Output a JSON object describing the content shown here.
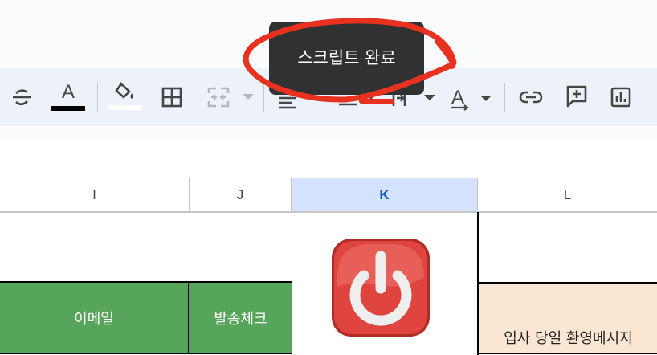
{
  "tooltip": {
    "text": "스크립트 완료"
  },
  "toolbar": {
    "icons": [
      "strikethrough-icon",
      "text-color-icon",
      "fill-color-icon",
      "borders-icon",
      "merge-cells-icon",
      "horizontal-align-icon",
      "vertical-align-icon",
      "text-wrap-icon",
      "text-rotation-icon",
      "insert-link-icon",
      "insert-comment-icon",
      "insert-chart-icon"
    ],
    "text_color_glyph": "A",
    "text_color": "#000000",
    "fill_color": "#ffffff"
  },
  "columns": [
    "I",
    "J",
    "K",
    "L"
  ],
  "selected_column": "K",
  "cells": {
    "email": "이메일",
    "send_check": "발송체크",
    "welcome_message": "입사 당일 환영메시지"
  },
  "colors": {
    "green_header": "#57a55a",
    "peach_header": "#fbe5d3",
    "selected_col_bg": "#d3e3fd",
    "power_button": "#e0443e",
    "annotation": "#e8321f"
  },
  "icons": {
    "script_button": "power-icon"
  }
}
